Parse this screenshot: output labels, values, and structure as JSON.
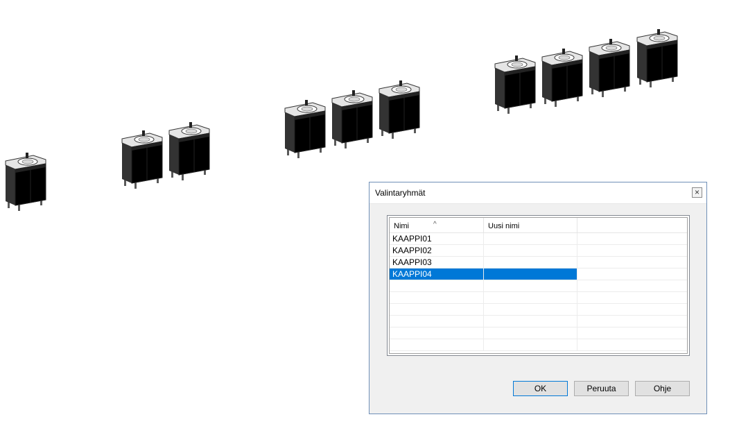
{
  "viewport": {
    "cabinets": [
      {
        "group": "KAAPPI01",
        "color": "#d2d2d2"
      },
      {
        "group": "KAAPPI02",
        "color": "#d2d2d2"
      },
      {
        "group": "KAAPPI02",
        "color": "#d2d2d2"
      },
      {
        "group": "KAAPPI03",
        "color": "#d2d2d2"
      },
      {
        "group": "KAAPPI03",
        "color": "#d2d2d2"
      },
      {
        "group": "KAAPPI03",
        "color": "#d2d2d2"
      },
      {
        "group": "KAAPPI04",
        "color": "#2fcfcf"
      },
      {
        "group": "KAAPPI04",
        "color": "#2fcfcf"
      },
      {
        "group": "KAAPPI04",
        "color": "#2fcfcf"
      },
      {
        "group": "KAAPPI04",
        "color": "#2fcfcf"
      }
    ]
  },
  "dialog": {
    "title": "Valintaryhmät",
    "close_glyph": "×",
    "columns": {
      "name": "Nimi",
      "new_name": "Uusi nimi"
    },
    "rows": [
      {
        "name": "KAAPPI01",
        "new_name": "",
        "selected": false
      },
      {
        "name": "KAAPPI02",
        "new_name": "",
        "selected": false
      },
      {
        "name": "KAAPPI03",
        "new_name": "",
        "selected": false
      },
      {
        "name": "KAAPPI04",
        "new_name": "",
        "selected": true
      }
    ],
    "buttons": {
      "ok": "OK",
      "cancel": "Peruuta",
      "help": "Ohje"
    },
    "selection_color": "#0078d7"
  }
}
